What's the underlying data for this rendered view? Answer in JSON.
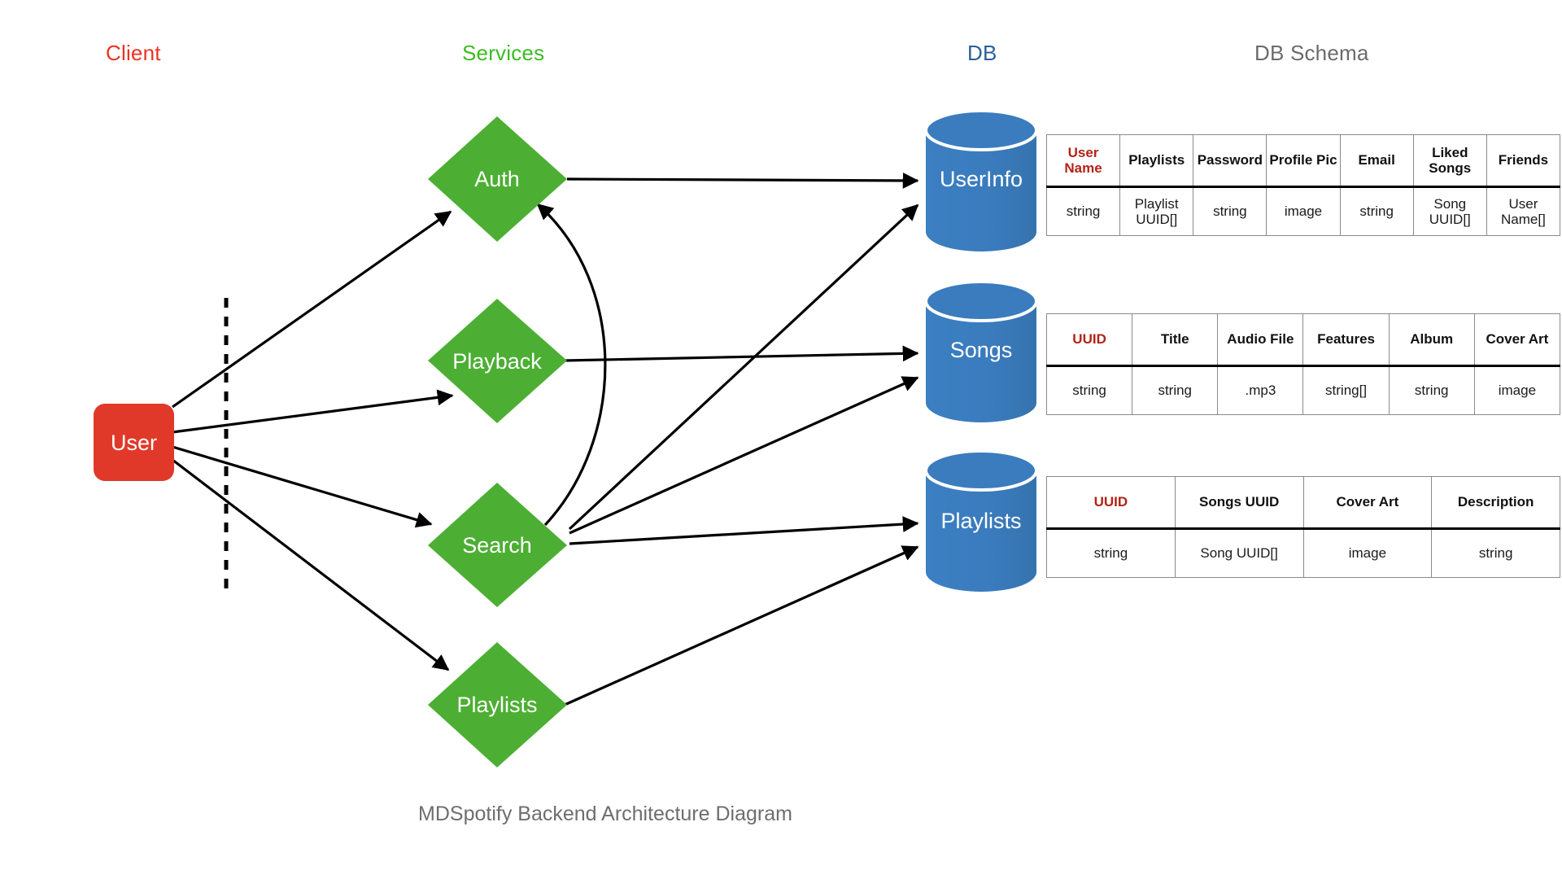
{
  "caption": "MDSpotify Backend Architecture Diagram",
  "columns": {
    "client": {
      "label": "Client",
      "color": "#EA3323"
    },
    "services": {
      "label": "Services",
      "color": "#3DBB25"
    },
    "db": {
      "label": "DB",
      "color": "#2A6099"
    },
    "schema": {
      "label": "DB Schema",
      "color": "#6B6B6B"
    }
  },
  "client": {
    "node_label": "User",
    "color": "#E0392A"
  },
  "services": {
    "color": "#4CAF33",
    "nodes": [
      {
        "label": "Auth"
      },
      {
        "label": "Playback"
      },
      {
        "label": "Search"
      },
      {
        "label": "Playlists"
      }
    ]
  },
  "databases": {
    "color": "#3A7CBE",
    "nodes": [
      {
        "label": "UserInfo"
      },
      {
        "label": "Songs"
      },
      {
        "label": "Playlists"
      }
    ]
  },
  "schema_tables": [
    {
      "name": "UserInfo",
      "headers": [
        "User Name",
        "Playlists",
        "Password",
        "Profile Pic",
        "Email",
        "Liked Songs",
        "Friends"
      ],
      "primary_key_index": 0,
      "row": [
        "string",
        "Playlist UUID[]",
        "string",
        "image",
        "string",
        "Song UUID[]",
        "User Name[]"
      ]
    },
    {
      "name": "Songs",
      "headers": [
        "UUID",
        "Title",
        "Audio File",
        "Features",
        "Album",
        "Cover Art"
      ],
      "primary_key_index": 0,
      "row": [
        "string",
        "string",
        ".mp3",
        "string[]",
        "string",
        "image"
      ]
    },
    {
      "name": "Playlists",
      "headers": [
        "UUID",
        "Songs UUID",
        "Cover Art",
        "Description"
      ],
      "primary_key_index": 0,
      "row": [
        "string",
        "Song UUID[]",
        "image",
        "string"
      ]
    }
  ],
  "connections": [
    {
      "from": "User",
      "to": "Auth"
    },
    {
      "from": "User",
      "to": "Playback"
    },
    {
      "from": "User",
      "to": "Search"
    },
    {
      "from": "User",
      "to": "Playlists"
    },
    {
      "from": "Search",
      "to": "Auth"
    },
    {
      "from": "Auth",
      "to": "UserInfo"
    },
    {
      "from": "Search",
      "to": "UserInfo"
    },
    {
      "from": "Playback",
      "to": "Songs"
    },
    {
      "from": "Search",
      "to": "Songs"
    },
    {
      "from": "Search",
      "to": "Playlists DB"
    },
    {
      "from": "Playlists",
      "to": "Playlists DB"
    }
  ]
}
